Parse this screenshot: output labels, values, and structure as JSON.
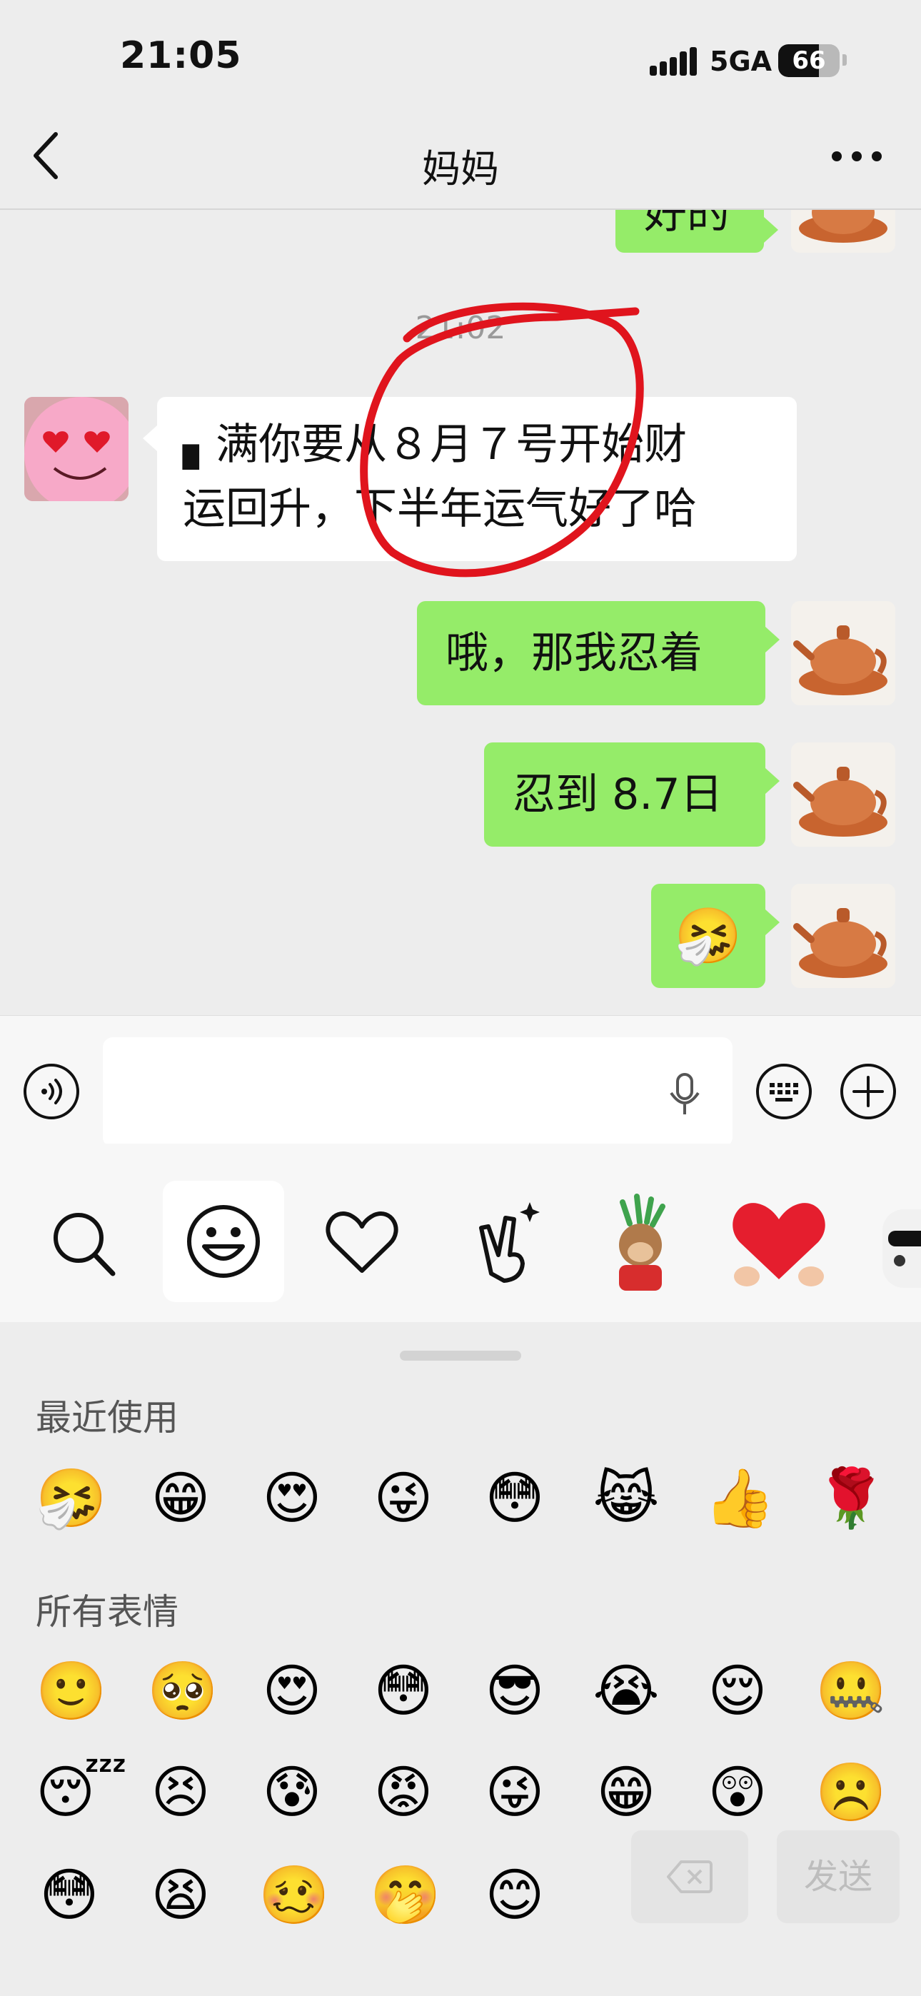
{
  "status_bar": {
    "time": "21:05",
    "network": "5GA",
    "battery": "66",
    "battery_level": 0.66
  },
  "nav": {
    "title": "妈妈"
  },
  "chat": {
    "partial_message": "好的",
    "timestamp": "21:02",
    "messages": [
      {
        "from": "them",
        "lines": [
          "▖满你要从８月７号开始财",
          "运回升，下半年运气好了哈"
        ]
      },
      {
        "from": "me",
        "text": "哦，那我忍着"
      },
      {
        "from": "me",
        "text": "忍到 8.7日"
      },
      {
        "from": "me",
        "emoji": "🤧"
      }
    ],
    "annotation_color": "#e0141d"
  },
  "emoji_panel": {
    "recent_title": "最近使用",
    "all_title": "所有表情",
    "recent": [
      "🤧",
      "😁",
      "😍",
      "😜",
      "😳",
      "😹",
      "👍",
      "🌹"
    ],
    "all_rows": [
      [
        "🙂",
        "🥺",
        "😍",
        "😳",
        "😎",
        "😭",
        "😌",
        "🤐"
      ],
      [
        "😴",
        "😣",
        "😰",
        "😡",
        "😜",
        "😁",
        "😲",
        "☹️"
      ],
      [
        "😳",
        "😫",
        "🥴",
        "🤭",
        "😊"
      ]
    ],
    "delete_label": "⌫",
    "send_label": "发送"
  },
  "colors": {
    "bubble_me": "#95ec69",
    "bubble_them": "#ffffff",
    "background": "#ededed"
  }
}
